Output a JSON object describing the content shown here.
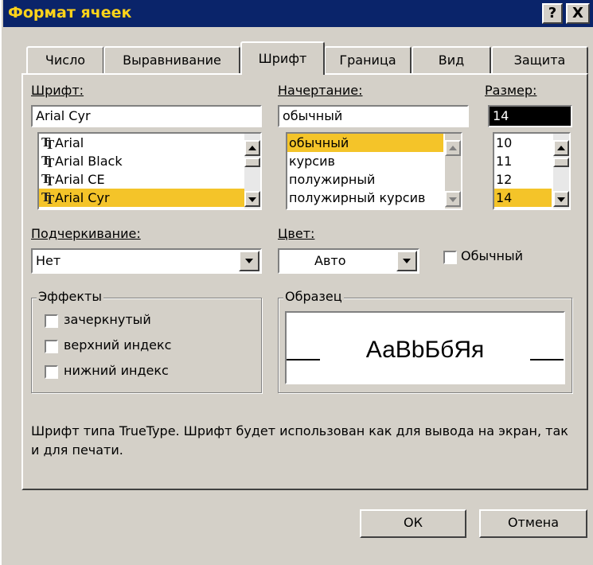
{
  "window": {
    "title": "Формат ячеек",
    "help_label": "?",
    "close_label": "X"
  },
  "tabs": [
    {
      "label": "Число",
      "active": false
    },
    {
      "label": "Выравнивание",
      "active": false
    },
    {
      "label": "Шрифт",
      "active": true
    },
    {
      "label": "Граница",
      "active": false
    },
    {
      "label": "Вид",
      "active": false
    },
    {
      "label": "Защита",
      "active": false
    }
  ],
  "font": {
    "label": "Шрифт:",
    "value": "Arial Cyr",
    "list": [
      "Arial",
      "Arial Black",
      "Arial CE",
      "Arial Cyr"
    ],
    "selected": "Arial Cyr",
    "icon": "truetype-icon"
  },
  "style": {
    "label": "Начертание:",
    "value": "обычный",
    "list": [
      "обычный",
      "курсив",
      "полужирный",
      "полужирный курсив"
    ],
    "selected": "обычный"
  },
  "size": {
    "label": "Размер:",
    "value": "14",
    "list": [
      "10",
      "11",
      "12",
      "14"
    ],
    "selected": "14"
  },
  "underline": {
    "label": "Подчеркивание:",
    "value": "Нет"
  },
  "color": {
    "label": "Цвет:",
    "value": "Авто"
  },
  "normal_font": {
    "label": "Обычный",
    "checked": false
  },
  "effects": {
    "title": "Эффекты",
    "items": [
      {
        "label": "зачеркнутый",
        "checked": false
      },
      {
        "label": "верхний индекс",
        "checked": false
      },
      {
        "label": "нижний индекс",
        "checked": false
      }
    ]
  },
  "preview": {
    "title": "Образец",
    "text": "АаBbБбЯя"
  },
  "info_text": "Шрифт типа TrueType. Шрифт будет использован как для вывода на экран, так и для печати.",
  "buttons": {
    "ok": "ОК",
    "cancel": "Отмена"
  },
  "colors": {
    "title_bar": "#0a246a",
    "title_text": "#ffd31a",
    "dialog_face": "#d4d0c8",
    "selection": "#f4c429",
    "size_field": "#000000"
  }
}
